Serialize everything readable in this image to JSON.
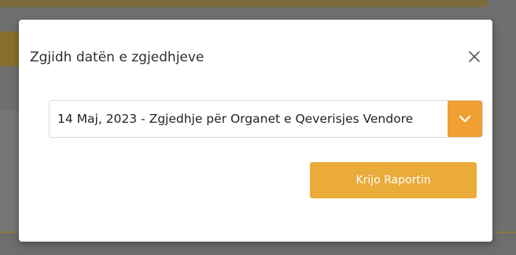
{
  "modal": {
    "title": "Zgjidh datën e zgjedhjeve",
    "close_icon": "close-icon",
    "election_select": {
      "selected_value": "14 Maj, 2023 - Zgjedhje për Organet e Qeverisjes Vendore",
      "arrow_icon": "chevron-down-icon"
    },
    "create_report_label": "Krijo Raportin"
  },
  "colors": {
    "accent": "#f0a033",
    "button": "#ebab38",
    "overlay": "#6f6f6f"
  }
}
